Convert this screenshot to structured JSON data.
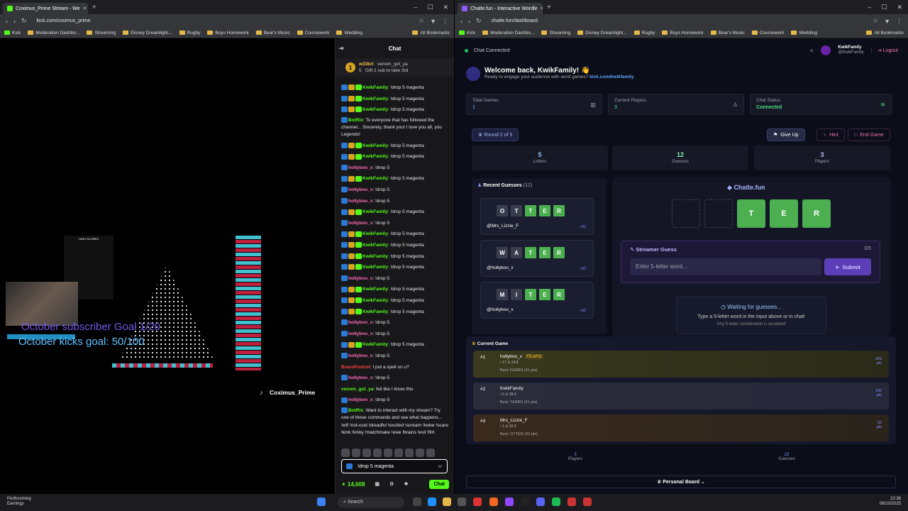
{
  "left": {
    "tab_title": "Coximus_Prime Stream - We",
    "url": "kick.com/coximus_prime",
    "bookmarks": [
      "Kick",
      "Moderation Dashbo...",
      "Streaming",
      "Disney Dreamlight...",
      "Rugby",
      "Boys Homework",
      "Bear's Music",
      "Coursework",
      "Wedding"
    ],
    "all_bookmarks": "All Bookmarks",
    "stream": {
      "channel_name": "Coximus_Prime",
      "sub_goal": "October subscriber Goal 1/20",
      "kicks_goal": "October kicks goal: 50/100",
      "leaderboard_title": "HIGH SCORES"
    },
    "chat": {
      "title": "Chat",
      "pinned_user": "w33brl",
      "pinned_count": "5",
      "pinned_target": "venom_got_ya",
      "pinned_text": "Gift 1 sub to take 3rd",
      "messages": [
        {
          "user": "KwikFamily",
          "text": "!drop 5 magenta",
          "color": "#53fc18",
          "badges": 3
        },
        {
          "user": "KwikFamily",
          "text": "!drop 5 magenta",
          "color": "#53fc18",
          "badges": 3
        },
        {
          "user": "KwikFamily",
          "text": "!drop 5 magenta",
          "color": "#53fc18",
          "badges": 3
        },
        {
          "user": "BotRix",
          "text": "To everyone that has followed the channel... Sincerely, thank you! I love you all, you Legends!",
          "color": "#53fc18",
          "badges": 1,
          "wrap": true
        },
        {
          "user": "KwikFamily",
          "text": "!drop 5 magenta",
          "color": "#53fc18",
          "badges": 3
        },
        {
          "user": "KwikFamily",
          "text": "!drop 5 magenta",
          "color": "#53fc18",
          "badges": 3
        },
        {
          "user": "hollyboo_x",
          "text": "!drop 5",
          "color": "#ff6bb5",
          "badges": 1
        },
        {
          "user": "KwikFamily",
          "text": "!drop 5 magenta",
          "color": "#53fc18",
          "badges": 3
        },
        {
          "user": "hollyboo_x",
          "text": "!drop 5",
          "color": "#ff6bb5",
          "badges": 1
        },
        {
          "user": "hollyboo_x",
          "text": "!drop 5",
          "color": "#ff6bb5",
          "badges": 1
        },
        {
          "user": "KwikFamily",
          "text": "!drop 5 magenta",
          "color": "#53fc18",
          "badges": 3
        },
        {
          "user": "hollyboo_x",
          "text": "!drop 5",
          "color": "#ff6bb5",
          "badges": 1
        },
        {
          "user": "KwikFamily",
          "text": "!drop 5 magenta",
          "color": "#53fc18",
          "badges": 3
        },
        {
          "user": "KwikFamily",
          "text": "!drop 5 magenta",
          "color": "#53fc18",
          "badges": 3
        },
        {
          "user": "KwikFamily",
          "text": "!drop 5 magenta",
          "color": "#53fc18",
          "badges": 3
        },
        {
          "user": "KwikFamily",
          "text": "!drop 5 magenta",
          "color": "#53fc18",
          "badges": 3
        },
        {
          "user": "hollyboo_x",
          "text": "!drop 5",
          "color": "#ff6bb5",
          "badges": 1
        },
        {
          "user": "KwikFamily",
          "text": "!drop 5 magenta",
          "color": "#53fc18",
          "badges": 3
        },
        {
          "user": "KwikFamily",
          "text": "!drop 5 magenta",
          "color": "#53fc18",
          "badges": 3
        },
        {
          "user": "KwikFamily",
          "text": "!drop 5 magenta",
          "color": "#53fc18",
          "badges": 3
        },
        {
          "user": "hollyboo_x",
          "text": "!drop 5",
          "color": "#ff6bb5",
          "badges": 1
        },
        {
          "user": "hollyboo_x",
          "text": "!drop 5",
          "color": "#ff6bb5",
          "badges": 1
        },
        {
          "user": "KwikFamily",
          "text": "!drop 5 magenta",
          "color": "#53fc18",
          "badges": 3
        },
        {
          "user": "hollyboo_x",
          "text": "!drop 5",
          "color": "#ff6bb5",
          "badges": 1
        },
        {
          "user": "BravoFoxtrot",
          "text": "I put a spell on u?",
          "color": "#ff4040",
          "badges": 0
        },
        {
          "user": "hollyboo_x",
          "text": "!drop 5",
          "color": "#ff6bb5",
          "badges": 1
        },
        {
          "user": "venom_got_ya",
          "text": "feil like I know this",
          "color": "#53fc18",
          "badges": 0
        },
        {
          "user": "hollyboo_x",
          "text": "!drop 5",
          "color": "#ff6bb5",
          "badges": 1
        },
        {
          "user": "BotRix",
          "text": "Want to interact with my stream? Try one of these commands and see what happens... !wtf !not-cool !dreadful !excited !scream !kekw !scare !kink !kinky !matchmake !ewe !brains !evil !flirt",
          "color": "#53fc18",
          "badges": 1,
          "wrap": true
        }
      ],
      "input_value": "!drop 5 magenta",
      "points": "14,608",
      "send_label": "Chat"
    }
  },
  "right": {
    "tab_title": "Chatle.fun - Interactive Wordle",
    "url": "chatle.fun/dashboard",
    "bookmarks": [
      "Kick",
      "Moderation Dashbo...",
      "Streaming",
      "Disney Dreamlight...",
      "Rugby",
      "Boys Homework",
      "Bear's Music",
      "Coursework",
      "Wedding"
    ],
    "all_bookmarks": "All Bookmarks",
    "app": {
      "status": "Chat Connected",
      "username": "KwikFamily",
      "handle": "@KwikFamily",
      "logout": "Logout",
      "welcome": "Welcome back, KwikFamily! 👋",
      "subtitle": "Ready to engage your audience with word games?",
      "subtitle_link": "kick.com/kwikfamily",
      "stats": [
        {
          "label": "Total Games",
          "value": "1"
        },
        {
          "label": "Current Players",
          "value": "3"
        },
        {
          "label": "Chat Status",
          "value": "Connected"
        }
      ],
      "round": "Round 2 of 5",
      "give_up": "Give Up",
      "hint": "Hint",
      "end_game": "End Game",
      "counters": [
        {
          "value": "5",
          "label": "Letters"
        },
        {
          "value": "12",
          "label": "Guesses"
        },
        {
          "value": "3",
          "label": "Players"
        }
      ],
      "recent_title": "Recent Guesses",
      "recent_count": "(12)",
      "recent": [
        {
          "letters": [
            "O",
            "T",
            "T",
            "E",
            "R"
          ],
          "greens": [
            false,
            false,
            true,
            true,
            true
          ],
          "user": "@Mrs_Lizzie_F",
          "pts": "+32"
        },
        {
          "letters": [
            "W",
            "A",
            "T",
            "E",
            "R"
          ],
          "greens": [
            false,
            false,
            true,
            true,
            true
          ],
          "user": "@hollyboo_x",
          "pts": "+32"
        },
        {
          "letters": [
            "M",
            "I",
            "T",
            "E",
            "R"
          ],
          "greens": [
            false,
            false,
            true,
            true,
            true
          ],
          "user": "@hollyboo_x",
          "pts": "+32"
        }
      ],
      "brand": "Chatle.fun",
      "board": [
        "",
        "",
        "T",
        "E",
        "R"
      ],
      "streamer_guess_title": "Streamer Guess",
      "streamer_guess_count": "0/5",
      "guess_placeholder": "Enter 5-letter word...",
      "submit": "Submit",
      "waiting_title": "Waiting for guesses...",
      "waiting_text": "Type a 5-letter word in the input above or in chat!",
      "waiting_sub": "Any 5-letter combination is accepted",
      "current_title": "Current Game",
      "leaders": [
        {
          "rank": "#1",
          "name": "hollyboo_x",
          "tag": "FEARS",
          "sub": "• 17 ⊘ 24.8",
          "best": "Best: FEARS (41 pts)",
          "pts": "423",
          "unit": "pts"
        },
        {
          "rank": "#2",
          "name": "KwikFamily",
          "tag": "",
          "sub": "• 5 ⊘ 28.4",
          "best": "Best: TEARS (41 pts)",
          "pts": "142",
          "unit": "pts"
        },
        {
          "rank": "#3",
          "name": "Mrs_Lizzie_F",
          "tag": "",
          "sub": "• 1 ⊘ 32.0",
          "best": "Best: OTTER (32 pts)",
          "pts": "32",
          "unit": "pts"
        }
      ],
      "total_players_value": "3",
      "total_players_label": "Players",
      "total_guesses_value": "23",
      "total_guesses_label": "Guesses",
      "personal_board": "Personal Board"
    }
  },
  "taskbar": {
    "weather_title": "Porthcoming",
    "weather_sub": "Earnings",
    "search": "Search",
    "time": "22:36",
    "date": "08/10/2025"
  }
}
